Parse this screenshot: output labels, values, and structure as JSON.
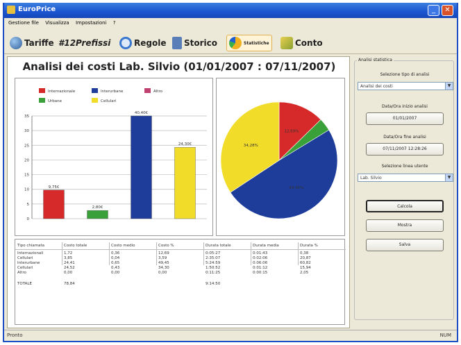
{
  "window": {
    "title": "EuroPrice"
  },
  "menu": [
    "Gestione file",
    "Visualizza",
    "Impostazioni",
    "?"
  ],
  "toolbar": [
    {
      "label": "Tariffe",
      "icon": "globe-icon",
      "color": "#3a6ea5"
    },
    {
      "label": "#12Prefissi",
      "icon": "",
      "color": ""
    },
    {
      "label": "Regole",
      "icon": "refresh-icon",
      "color": "#3a78d0"
    },
    {
      "label": "Storico",
      "icon": "book-icon",
      "color": "#5a7fb8"
    },
    {
      "label": "Statistiche",
      "icon": "chart-pie-icon",
      "color": "#f0b020"
    },
    {
      "label": "Conto",
      "icon": "money-icon",
      "color": "#d8b030"
    }
  ],
  "main": {
    "title": "Analisi dei costi Lab. Silvio (01/01/2007 : 07/11/2007)"
  },
  "chart_data": [
    {
      "type": "bar",
      "categories": [
        "Internazionale",
        "Urbane",
        "Interurbane",
        "Cellulari"
      ],
      "values": [
        9.75,
        2.8,
        40.4,
        24.3
      ],
      "value_labels": [
        "9,75€",
        "2,80€",
        "40,40€",
        "24,30€"
      ],
      "series_colors": [
        "#d62a2a",
        "#3aa03a",
        "#1e3d9a",
        "#f2dc2a"
      ],
      "legend": [
        {
          "label": "Internazionale",
          "color": "#d62a2a"
        },
        {
          "label": "Interurbane",
          "color": "#1e3d9a"
        },
        {
          "label": "Altro",
          "color": "#c04070"
        },
        {
          "label": "Urbane",
          "color": "#3aa03a"
        },
        {
          "label": "Cellulari",
          "color": "#f2dc2a"
        }
      ],
      "yticks": [
        0,
        5,
        10,
        15,
        20,
        25,
        30,
        35
      ],
      "ylim": [
        0,
        35
      ],
      "grid": true,
      "legend_position": "top"
    },
    {
      "type": "pie",
      "labels": [
        "Internazionale",
        "Urbane",
        "Interurbane",
        "Cellulari"
      ],
      "values": [
        12.69,
        3.59,
        49.45,
        34.28
      ],
      "colors": [
        "#d62a2a",
        "#3aa03a",
        "#1e3d9a",
        "#f2dc2a"
      ],
      "slice_labels": [
        "12,69%",
        "",
        "49,45%",
        "34,28%"
      ]
    }
  ],
  "table": {
    "headers": [
      "Tipo chiamata",
      "Costo totale",
      "Costo medio",
      "Costo %",
      "Durata totale",
      "Durata media",
      "Durata %"
    ],
    "rows": [
      [
        "Internazionali",
        "1,72",
        "0,36",
        "12,69",
        "0:05:27",
        "0:01:43",
        "0,38"
      ],
      [
        "Cellulari",
        "3,85",
        "0,04",
        "3,59",
        "2:35:07",
        "0:02:06",
        "20,87"
      ],
      [
        "Interurbane",
        "24,41",
        "0,65",
        "49,45",
        "5:24:59",
        "0:06:06",
        "60,82"
      ],
      [
        "Cellulari",
        "24,52",
        "0,43",
        "34,30",
        "1:50:52",
        "0:01:12",
        "15,94"
      ],
      [
        "Altro",
        "0,00",
        "0,00",
        "0,00",
        "0:11:25",
        "0:00:15",
        "2,05"
      ]
    ],
    "total_label": "TOTALE",
    "total_cost": "78,84",
    "total_duration": "9:14:50"
  },
  "sidebar": {
    "group_title": "Analisi statistica",
    "type_label": "Selezione tipo di analisi",
    "type_value": "Analisi dei costi",
    "start_label": "Data/Ora inizio analisi",
    "start_value": "01/01/2007",
    "end_label": "Data/Ora fine analisi",
    "end_value": "07/11/2007 12:28:26",
    "line_label": "Selezione linea utente",
    "line_value": "Lab. Silvio",
    "calc_button": "Calcola",
    "show_button": "Mostra",
    "save_button": "Salva"
  },
  "status": {
    "left": "Pronto",
    "right": "NUM"
  }
}
